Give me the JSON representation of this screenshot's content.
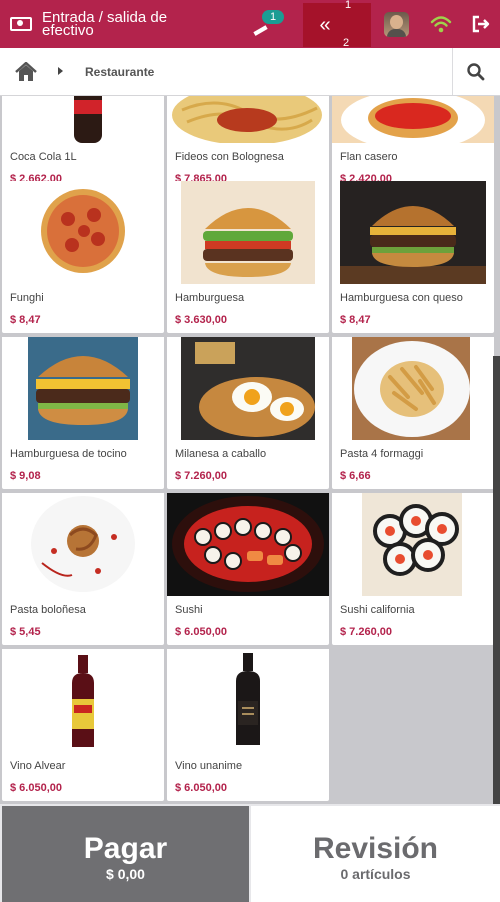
{
  "topbar": {
    "cash_label": "Entrada / salida de efectivo",
    "ticket_count": "1",
    "orders_top_num": "1",
    "orders_bottom_num": "2",
    "chevron": "«",
    "icons": {
      "cash": "cash-icon",
      "ticket": "ticket-icon",
      "wifi": "wifi-icon",
      "logout": "logout-icon",
      "orders": "chevron-double-left-icon"
    },
    "brand_color": "#b3234c"
  },
  "breadcrumb": {
    "items": [
      "Restaurante"
    ],
    "icons": {
      "home": "home-icon",
      "search": "search-icon"
    }
  },
  "products": [
    {
      "name": "Coca Cola 1L",
      "price": "$ 2.662,00"
    },
    {
      "name": "Fideos con Bolognesa",
      "price": "$ 7.865,00"
    },
    {
      "name": "Flan casero",
      "price": "$ 2.420,00"
    },
    {
      "name": "Funghi",
      "price": "$ 8,47"
    },
    {
      "name": "Hamburguesa",
      "price": "$ 3.630,00"
    },
    {
      "name": "Hamburguesa con queso",
      "price": "$ 8,47"
    },
    {
      "name": "Hamburguesa de tocino",
      "price": "$ 9,08"
    },
    {
      "name": "Milanesa a caballo",
      "price": "$ 7.260,00"
    },
    {
      "name": "Pasta 4 formaggi",
      "price": "$ 6,66"
    },
    {
      "name": "Pasta boloñesa",
      "price": "$ 5,45"
    },
    {
      "name": "Sushi",
      "price": "$ 6.050,00"
    },
    {
      "name": "Sushi california",
      "price": "$ 7.260,00"
    },
    {
      "name": "Vino Alvear",
      "price": "$ 6.050,00"
    },
    {
      "name": "Vino unanime",
      "price": "$ 6.050,00"
    }
  ],
  "actions": {
    "pay_label": "Pagar",
    "pay_amount": "$ 0,00",
    "review_label": "Revisión",
    "review_count": "0 artículos"
  },
  "colors": {
    "price": "#b3234c",
    "pay_bg": "#6f6f72",
    "badge": "#1a9d94"
  }
}
